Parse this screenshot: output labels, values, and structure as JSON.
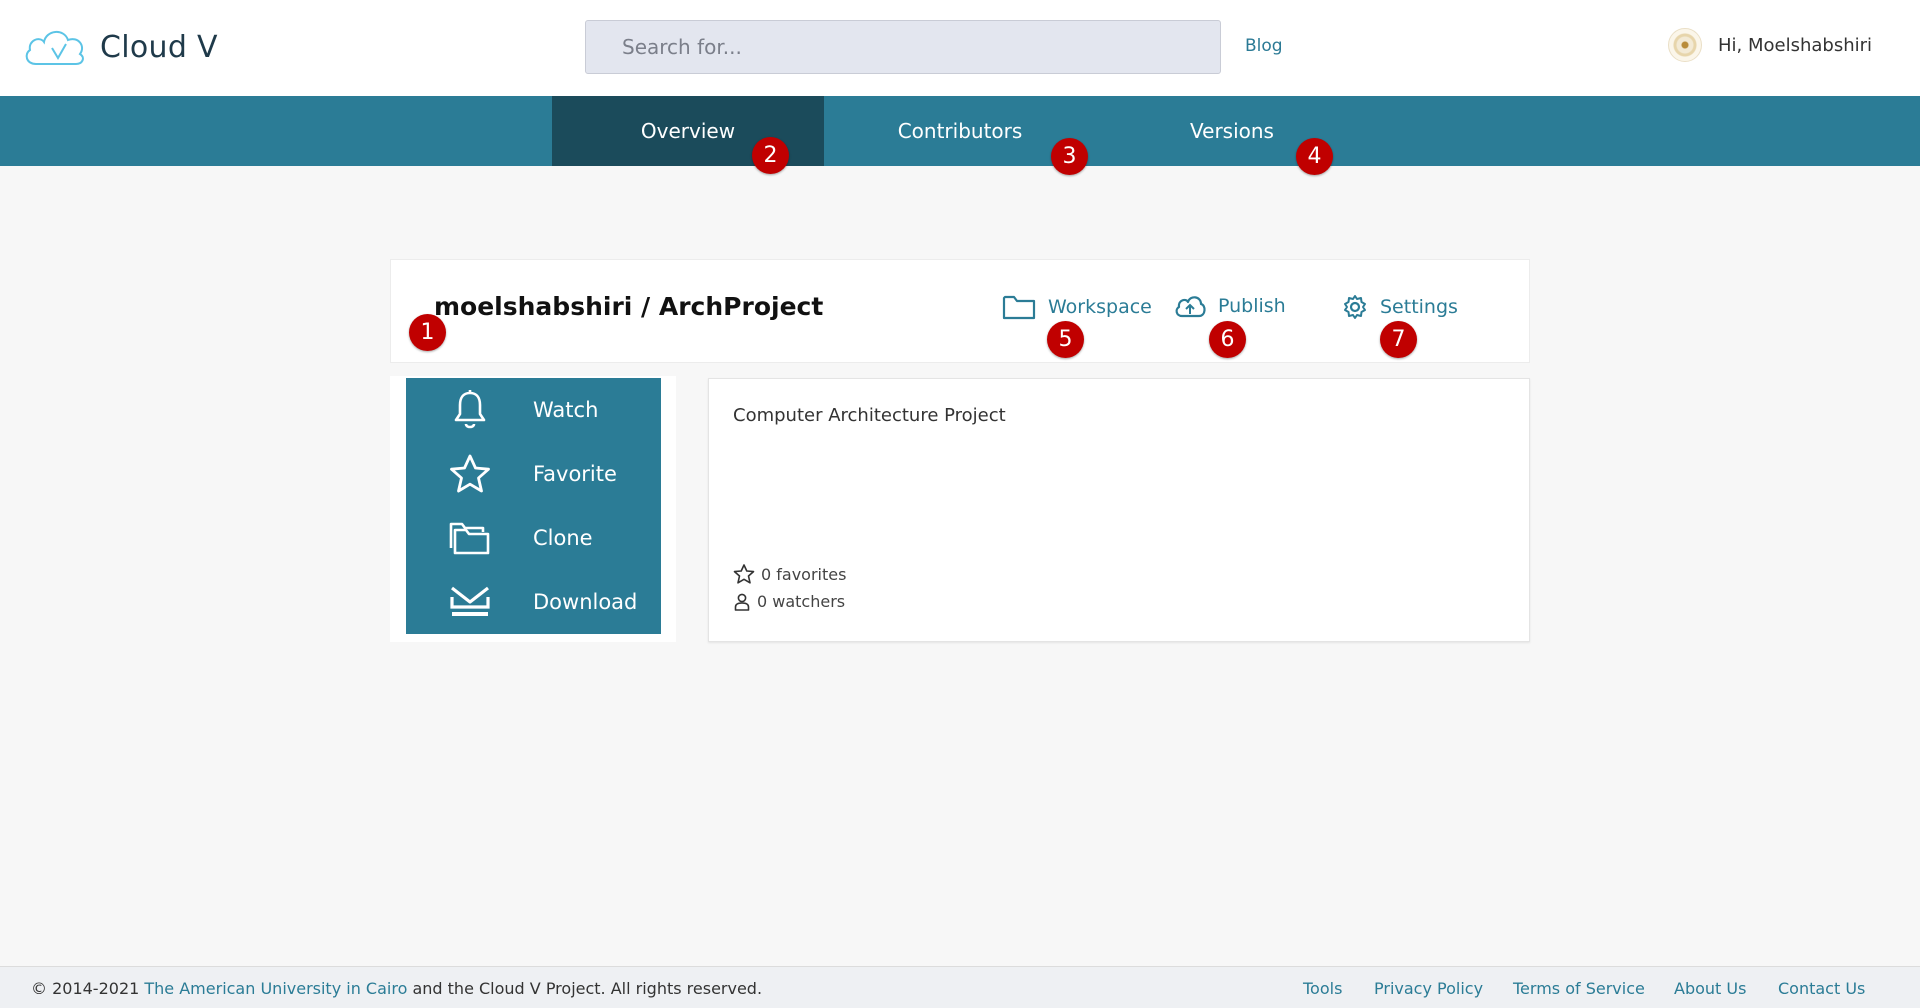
{
  "brand": {
    "name": "Cloud V",
    "color": "#5cc4e6"
  },
  "search": {
    "placeholder": "Search for..."
  },
  "nav": {
    "blog": "Blog"
  },
  "user": {
    "greeting": "Hi, Moelshabshiri"
  },
  "tabs": [
    {
      "label": "Overview",
      "active": true
    },
    {
      "label": "Contributors",
      "active": false
    },
    {
      "label": "Versions",
      "active": false
    }
  ],
  "project": {
    "title": "moelshabshiri / ArchProject",
    "actions": {
      "workspace": "Workspace",
      "publish": "Publish",
      "settings": "Settings"
    }
  },
  "sidebar": {
    "items": [
      {
        "label": "Watch",
        "icon": "bell-icon"
      },
      {
        "label": "Favorite",
        "icon": "star-icon"
      },
      {
        "label": "Clone",
        "icon": "folders-icon"
      },
      {
        "label": "Download",
        "icon": "download-tray-icon"
      }
    ]
  },
  "description": {
    "text": "Computer Architecture Project",
    "favorites": "0 favorites",
    "watchers": "0 watchers"
  },
  "badges": [
    "1",
    "2",
    "3",
    "4",
    "5",
    "6",
    "7"
  ],
  "footer": {
    "copy_prefix": "© 2014-2021 ",
    "copy_link": "The American University in Cairo",
    "copy_suffix": " and the Cloud V Project. All rights reserved.",
    "links": [
      "Tools",
      "Privacy Policy",
      "Terms of Service",
      "About Us",
      "Contact Us"
    ]
  },
  "colors": {
    "accent": "#2b7c96",
    "accent_dark": "#1b4b5b",
    "badge": "#c00000"
  }
}
